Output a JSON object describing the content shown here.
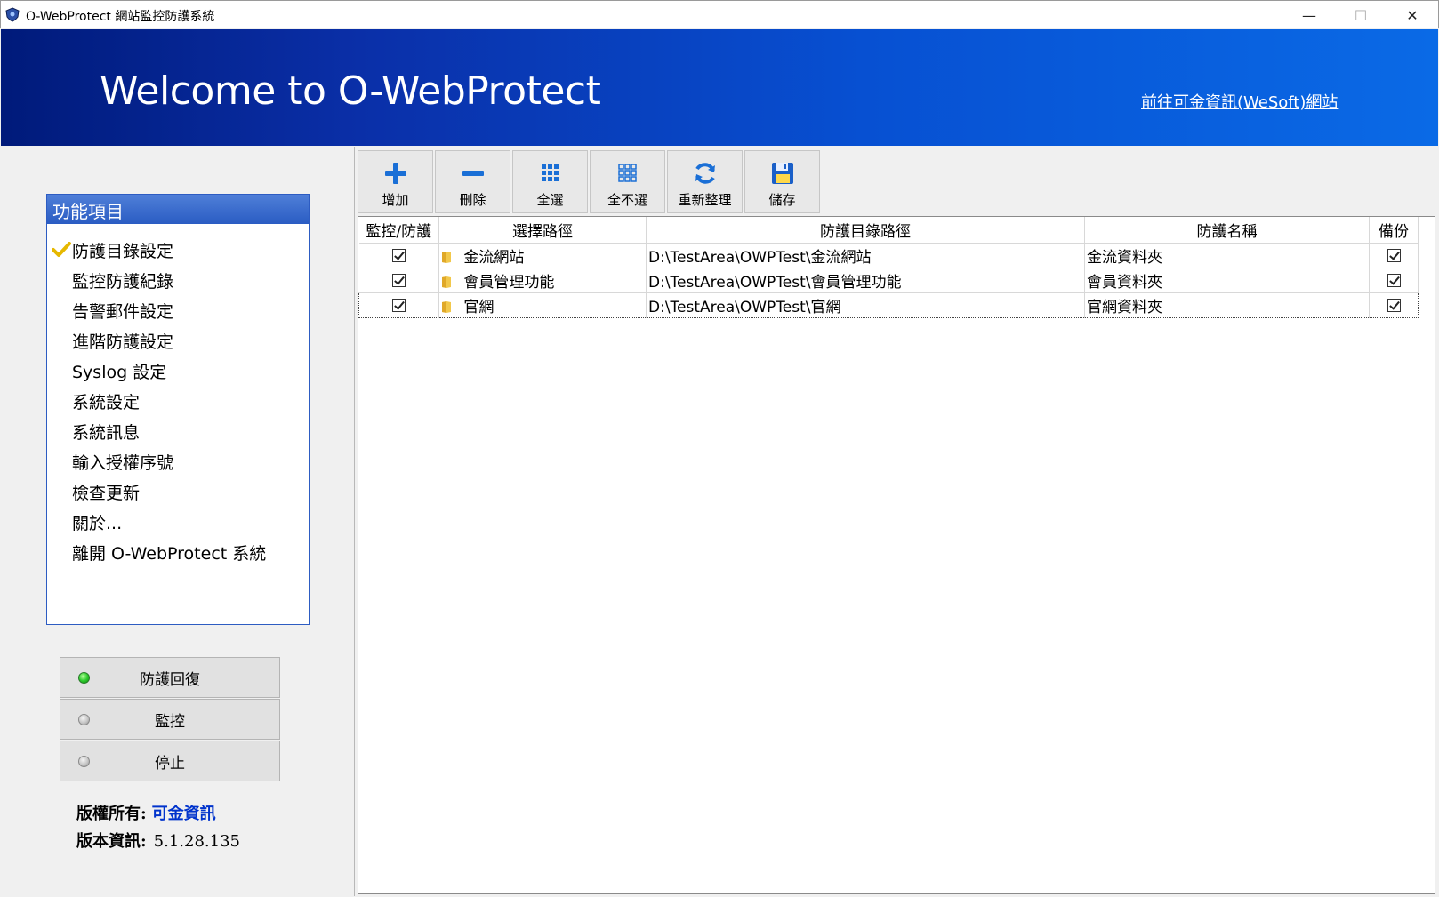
{
  "window": {
    "title": "O-WebProtect 網站監控防護系統",
    "controls": {
      "minimize": "—",
      "maximize": "☐",
      "close": "✕"
    }
  },
  "banner": {
    "welcome": "Welcome to O-WebProtect",
    "link": "前往可金資訊(WeSoft)網站"
  },
  "menu": {
    "header": "功能項目",
    "items": [
      {
        "label": "防護目錄設定",
        "checked": true
      },
      {
        "label": "監控防護紀錄"
      },
      {
        "label": "告警郵件設定"
      },
      {
        "label": "進階防護設定"
      },
      {
        "label": "Syslog 設定"
      },
      {
        "label": "系統設定"
      },
      {
        "label": "系統訊息"
      },
      {
        "label": "輸入授權序號"
      },
      {
        "label": "檢查更新"
      },
      {
        "label": "關於..."
      },
      {
        "label": "離開 O-WebProtect 系統"
      }
    ]
  },
  "controls": {
    "restore": "防護回復",
    "monitor": "監控",
    "stop": "停止",
    "active": "restore"
  },
  "info": {
    "copyright_label": "版權所有:",
    "company": "可金資訊",
    "version_label": "版本資訊:",
    "version": "5.1.28.135"
  },
  "toolbar": {
    "add": "增加",
    "delete": "刪除",
    "select_all": "全選",
    "select_none": "全不選",
    "refresh": "重新整理",
    "save": "儲存"
  },
  "table": {
    "headers": [
      "監控/防護",
      "選擇路徑",
      "防護目錄路徑",
      "防護名稱",
      "備份"
    ],
    "rows": [
      {
        "monitor": true,
        "path": "金流網站",
        "full_path": "D:\\TestArea\\OWPTest\\金流網站",
        "name": "金流資料夾",
        "backup": true
      },
      {
        "monitor": true,
        "path": "會員管理功能",
        "full_path": "D:\\TestArea\\OWPTest\\會員管理功能",
        "name": "會員資料夾",
        "backup": true
      },
      {
        "monitor": true,
        "path": "官網",
        "full_path": "D:\\TestArea\\OWPTest\\官網",
        "name": "官網資料夾",
        "backup": true
      }
    ],
    "selected_row": 2
  },
  "colors": {
    "banner_start": "#001a7a",
    "banner_end": "#0a6ae6",
    "menu_header": "#2a5cc3",
    "company": "#0033cc",
    "led_on": "#2fcc2f"
  }
}
